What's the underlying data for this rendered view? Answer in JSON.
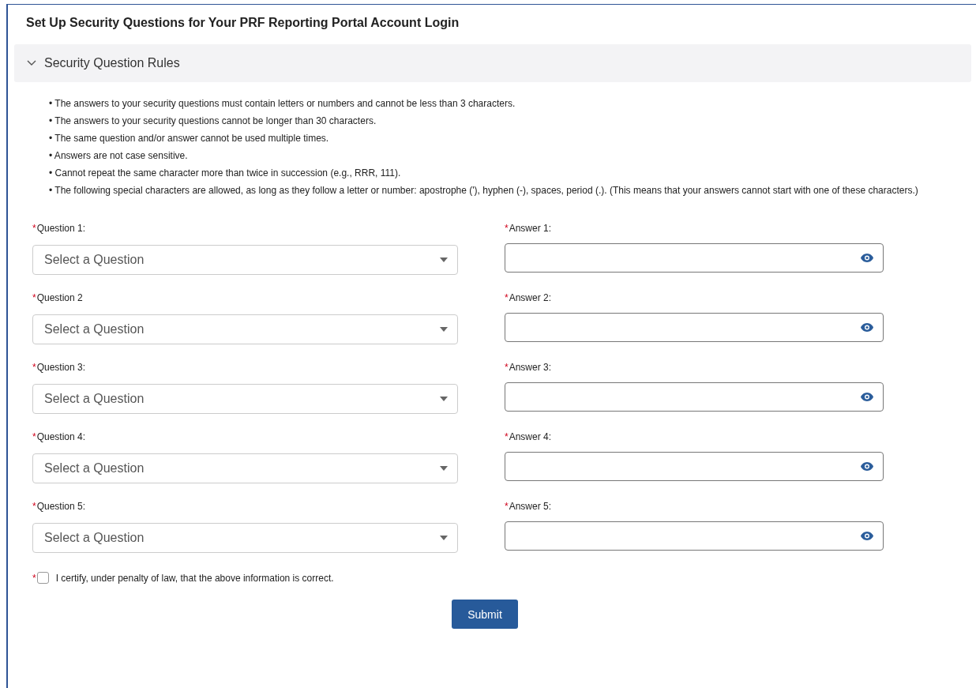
{
  "page_title": "Set Up Security Questions for Your PRF Reporting Portal Account Login",
  "rules_section": {
    "title": "Security Question Rules",
    "expanded": true,
    "rules": [
      "• The answers to your security questions must contain letters or numbers and cannot be less than 3 characters.",
      "• The answers to your security questions cannot be longer than 30 characters.",
      "• The same question and/or answer cannot be used multiple times.",
      "• Answers are not case sensitive.",
      "• Cannot repeat the same character more than twice in succession (e.g., RRR, 111).",
      "• The following special characters are allowed, as long as they follow a letter or number: apostrophe ('), hyphen (-), spaces, period (.). (This means that your answers cannot start with one of these characters.)"
    ]
  },
  "required_mark": "*",
  "question_rows": [
    {
      "question_label": "Question 1:",
      "question_placeholder": "Select a Question",
      "answer_label": "Answer 1:"
    },
    {
      "question_label": "Question 2",
      "question_placeholder": "Select a Question",
      "answer_label": "Answer 2:"
    },
    {
      "question_label": "Question 3:",
      "question_placeholder": "Select a Question",
      "answer_label": "Answer 3:"
    },
    {
      "question_label": "Question 4:",
      "question_placeholder": "Select a Question",
      "answer_label": "Answer 4:"
    },
    {
      "question_label": "Question 5:",
      "question_placeholder": "Select a Question",
      "answer_label": "Answer 5:"
    }
  ],
  "certify": {
    "label": "I certify, under penalty of law, that the above information is correct.",
    "checked": false
  },
  "submit_button": "Submit"
}
